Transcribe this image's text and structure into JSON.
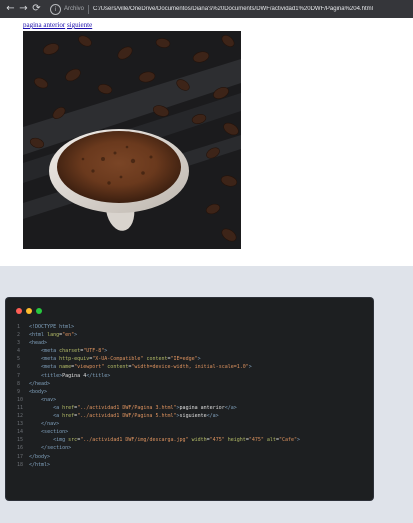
{
  "browser": {
    "back_icon": "arrow-left-icon",
    "forward_icon": "arrow-right-icon",
    "reload_icon": "reload-icon",
    "info_icon": "info-icon",
    "scheme_label": "Archivo",
    "url": "C:/Users/ville/OneDrive/Documentos/Diana's%20Documents/DWF/actividad1%20DWF/Pagina%204.html"
  },
  "page": {
    "nav": {
      "prev_label": "pagina anterior",
      "next_label": "siguiente"
    },
    "image_alt": "Cafe"
  },
  "code_window": {
    "dot_colors": [
      "#ff5f56",
      "#ffbd2e",
      "#27c93f"
    ],
    "lines": [
      {
        "n": "1",
        "parts": [
          [
            "tag",
            "<!DOCTYPE "
          ],
          [
            "tag",
            "html"
          ],
          [
            "tag",
            ">"
          ]
        ]
      },
      {
        "n": "2",
        "parts": [
          [
            "tag",
            "<html "
          ],
          [
            "attr",
            "lang"
          ],
          [
            "txt",
            "="
          ],
          [
            "str",
            "\"en\""
          ],
          [
            "tag",
            ">"
          ]
        ]
      },
      {
        "n": "3",
        "parts": [
          [
            "tag",
            "<head>"
          ]
        ]
      },
      {
        "n": "4",
        "parts": [
          [
            "txt",
            "    "
          ],
          [
            "tag",
            "<meta "
          ],
          [
            "attr",
            "charset"
          ],
          [
            "txt",
            "="
          ],
          [
            "str",
            "\"UTF-8\""
          ],
          [
            "tag",
            ">"
          ]
        ]
      },
      {
        "n": "5",
        "parts": [
          [
            "txt",
            "    "
          ],
          [
            "tag",
            "<meta "
          ],
          [
            "attr",
            "http-equiv"
          ],
          [
            "txt",
            "="
          ],
          [
            "str",
            "\"X-UA-Compatible\""
          ],
          [
            "txt",
            " "
          ],
          [
            "attr",
            "content"
          ],
          [
            "txt",
            "="
          ],
          [
            "str",
            "\"IE=edge\""
          ],
          [
            "tag",
            ">"
          ]
        ]
      },
      {
        "n": "6",
        "parts": [
          [
            "txt",
            "    "
          ],
          [
            "tag",
            "<meta "
          ],
          [
            "attr",
            "name"
          ],
          [
            "txt",
            "="
          ],
          [
            "str",
            "\"viewport\""
          ],
          [
            "txt",
            " "
          ],
          [
            "attr",
            "content"
          ],
          [
            "txt",
            "="
          ],
          [
            "str",
            "\"width=device-width, initial-scale=1.0\""
          ],
          [
            "tag",
            ">"
          ]
        ]
      },
      {
        "n": "7",
        "parts": [
          [
            "txt",
            "    "
          ],
          [
            "tag",
            "<title>"
          ],
          [
            "txt",
            "Pagina 4"
          ],
          [
            "tag",
            "</title>"
          ]
        ]
      },
      {
        "n": "8",
        "parts": [
          [
            "tag",
            "</head>"
          ]
        ]
      },
      {
        "n": "9",
        "parts": [
          [
            "tag",
            "<body>"
          ]
        ]
      },
      {
        "n": "10",
        "parts": [
          [
            "txt",
            "    "
          ],
          [
            "tag",
            "<nav>"
          ]
        ]
      },
      {
        "n": "11",
        "parts": [
          [
            "txt",
            "        "
          ],
          [
            "tag",
            "<a "
          ],
          [
            "attr",
            "href"
          ],
          [
            "txt",
            "="
          ],
          [
            "str",
            "\"../actividad1 DWF/Pagina 3.html\""
          ],
          [
            "tag",
            ">"
          ],
          [
            "txt",
            "pagina anterior"
          ],
          [
            "tag",
            "</a>"
          ]
        ]
      },
      {
        "n": "12",
        "parts": [
          [
            "txt",
            "        "
          ],
          [
            "tag",
            "<a "
          ],
          [
            "attr",
            "href"
          ],
          [
            "txt",
            "="
          ],
          [
            "str",
            "\"../actividad1 DWF/Pagina 5.html\""
          ],
          [
            "tag",
            ">"
          ],
          [
            "txt",
            "siguiente"
          ],
          [
            "tag",
            "</a>"
          ]
        ]
      },
      {
        "n": "13",
        "parts": [
          [
            "txt",
            "    "
          ],
          [
            "tag",
            "</nav>"
          ]
        ]
      },
      {
        "n": "14",
        "parts": [
          [
            "txt",
            "    "
          ],
          [
            "tag",
            "<section>"
          ]
        ]
      },
      {
        "n": "15",
        "parts": [
          [
            "txt",
            "        "
          ],
          [
            "tag",
            "<img "
          ],
          [
            "attr",
            "src"
          ],
          [
            "txt",
            "="
          ],
          [
            "str",
            "\"../actividad1 DWF/img/descarga.jpg\""
          ],
          [
            "txt",
            " "
          ],
          [
            "attr",
            "width"
          ],
          [
            "txt",
            "="
          ],
          [
            "str",
            "\"475\""
          ],
          [
            "txt",
            " "
          ],
          [
            "attr",
            "height"
          ],
          [
            "txt",
            "="
          ],
          [
            "str",
            "\"475\""
          ],
          [
            "txt",
            " "
          ],
          [
            "attr",
            "alt"
          ],
          [
            "txt",
            "="
          ],
          [
            "str",
            "\"Cafe\""
          ],
          [
            "tag",
            ">"
          ]
        ]
      },
      {
        "n": "16",
        "parts": [
          [
            "txt",
            "    "
          ],
          [
            "tag",
            "</section>"
          ]
        ]
      },
      {
        "n": "17",
        "parts": [
          [
            "tag",
            "</body>"
          ]
        ]
      },
      {
        "n": "18",
        "parts": [
          [
            "tag",
            "</html>"
          ]
        ]
      }
    ]
  }
}
